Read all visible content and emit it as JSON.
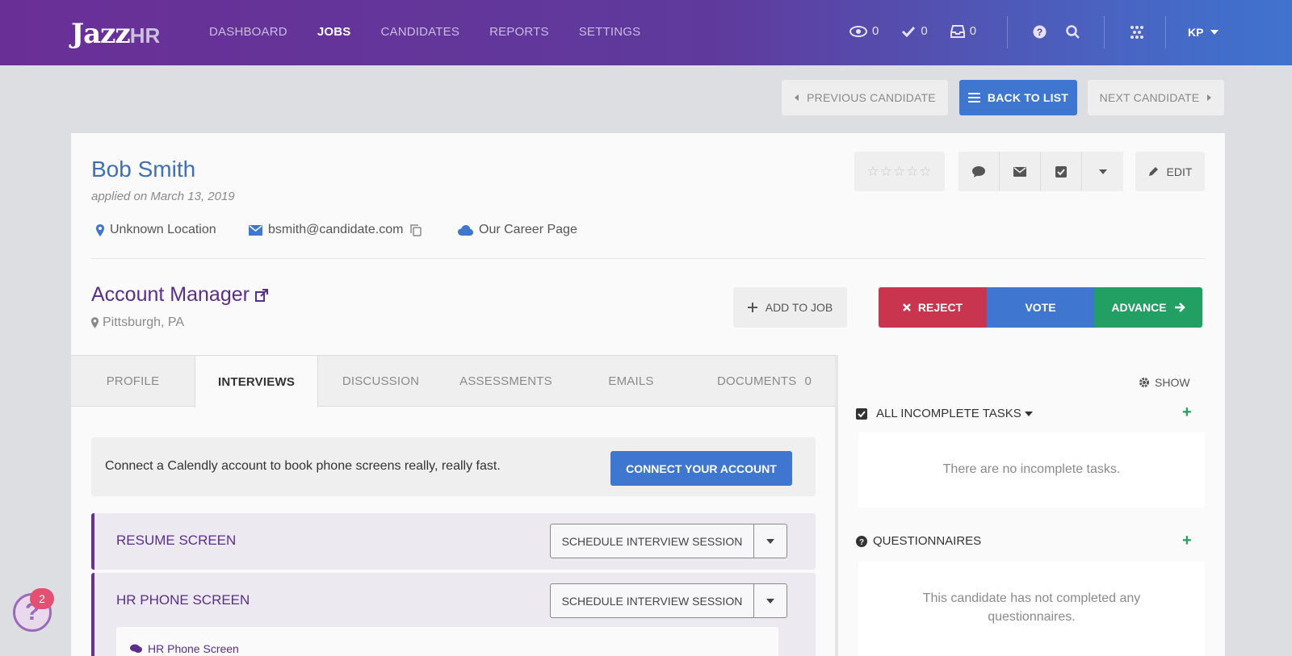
{
  "header": {
    "logo_main": "Jazz",
    "logo_sub": "HR",
    "nav": [
      "DASHBOARD",
      "JOBS",
      "CANDIDATES",
      "REPORTS",
      "SETTINGS"
    ],
    "active_nav": "JOBS",
    "views_count": "0",
    "tasks_count": "0",
    "inbox_count": "0",
    "user_initials": "KP"
  },
  "candidate_nav": {
    "previous": "PREVIOUS CANDIDATE",
    "back": "BACK TO LIST",
    "next": "NEXT CANDIDATE"
  },
  "candidate": {
    "name": "Bob Smith",
    "applied": "applied on March 13, 2019",
    "location": "Unknown Location",
    "email": "bsmith@candidate.com",
    "source": "Our Career Page",
    "rating_stars": "☆☆☆☆☆",
    "edit_label": "EDIT"
  },
  "job": {
    "title": "Account Manager",
    "location": "Pittsburgh, PA",
    "add_to_job": "ADD TO JOB",
    "reject": "REJECT",
    "vote": "VOTE",
    "advance": "ADVANCE"
  },
  "tabs": [
    "PROFILE",
    "INTERVIEWS",
    "DISCUSSION",
    "ASSESSMENTS",
    "EMAILS",
    "DOCUMENTS"
  ],
  "active_tab": "INTERVIEWS",
  "documents_count": "0",
  "calendly": {
    "message": "Connect a Calendly account to book phone screens really, really fast.",
    "button": "CONNECT YOUR ACCOUNT"
  },
  "stages": [
    {
      "title": "RESUME SCREEN",
      "button": "SCHEDULE INTERVIEW SESSION"
    },
    {
      "title": "HR PHONE SCREEN",
      "button": "SCHEDULE INTERVIEW SESSION",
      "sub_item": "HR Phone Screen"
    }
  ],
  "right_panel": {
    "show_label": "SHOW",
    "tasks_header": "ALL INCOMPLETE TASKS",
    "tasks_empty": "There are no incomplete tasks.",
    "questionnaires_header": "QUESTIONNAIRES",
    "questionnaires_empty": "This candidate has not completed any questionnaires."
  },
  "help_widget": {
    "icon": "?",
    "badge": "2"
  },
  "colors": {
    "brand_purple": "#6a2f97",
    "brand_blue": "#3f77d0",
    "reject_red": "#c9344e",
    "advance_green": "#22a064"
  }
}
